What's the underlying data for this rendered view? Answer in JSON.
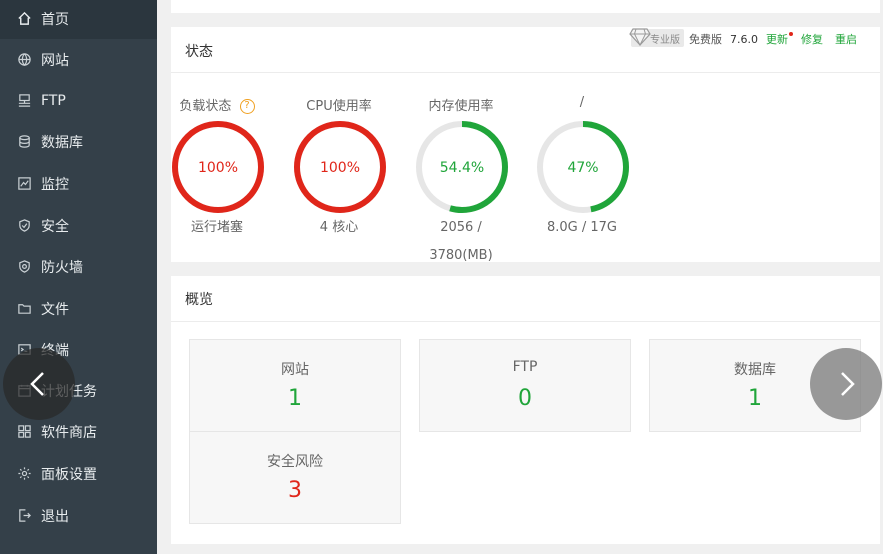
{
  "colors": {
    "sidebar_bg": "#344049",
    "accent_green": "#20a53a",
    "alert_red": "#e0261a",
    "danger_red": "#d9534f"
  },
  "sidebar": {
    "items": [
      {
        "label": "首页",
        "icon": "home-icon",
        "active": true
      },
      {
        "label": "网站",
        "icon": "globe-icon"
      },
      {
        "label": "FTP",
        "icon": "ftp-icon"
      },
      {
        "label": "数据库",
        "icon": "database-icon"
      },
      {
        "label": "监控",
        "icon": "monitor-icon"
      },
      {
        "label": "安全",
        "icon": "shield-icon"
      },
      {
        "label": "防火墙",
        "icon": "firewall-icon"
      },
      {
        "label": "文件",
        "icon": "folder-icon"
      },
      {
        "label": "终端",
        "icon": "terminal-icon"
      },
      {
        "label": "计划任务",
        "icon": "calendar-icon"
      },
      {
        "label": "软件商店",
        "icon": "grid-icon"
      },
      {
        "label": "面板设置",
        "icon": "gear-icon"
      },
      {
        "label": "退出",
        "icon": "logout-icon"
      }
    ]
  },
  "status": {
    "title": "状态",
    "pro_label": "专业版",
    "edition": "免费版",
    "version": "7.6.0",
    "update_label": "更新",
    "repair_label": "修复",
    "restart_label": "重启",
    "help_glyph": "?",
    "gauges": [
      {
        "label": "负载状态",
        "percent_text": "100%",
        "percent": 100,
        "sub": "运行堵塞",
        "color": "#e0261a"
      },
      {
        "label": "CPU使用率",
        "percent_text": "100%",
        "percent": 100,
        "sub": "4 核心",
        "color": "#e0261a"
      },
      {
        "label": "内存使用率",
        "percent_text": "54.4%",
        "percent": 54.4,
        "sub_line1": "2056 /",
        "sub_line2": "3780(MB)",
        "color": "#20a53a"
      },
      {
        "label": "/",
        "percent_text": "47%",
        "percent": 47,
        "sub": "8.0G / 17G",
        "color": "#20a53a"
      }
    ]
  },
  "overview": {
    "title": "概览",
    "cards": [
      {
        "label": "网站",
        "value": "1",
        "color": "#20a53a"
      },
      {
        "label": "FTP",
        "value": "0",
        "color": "#20a53a"
      },
      {
        "label": "数据库",
        "value": "1",
        "color": "#20a53a"
      },
      {
        "label": "安全风险",
        "value": "3",
        "color": "#e0261a"
      }
    ]
  },
  "carousel": {
    "prev_icon": "chevron-left-icon",
    "next_icon": "chevron-right-icon"
  }
}
